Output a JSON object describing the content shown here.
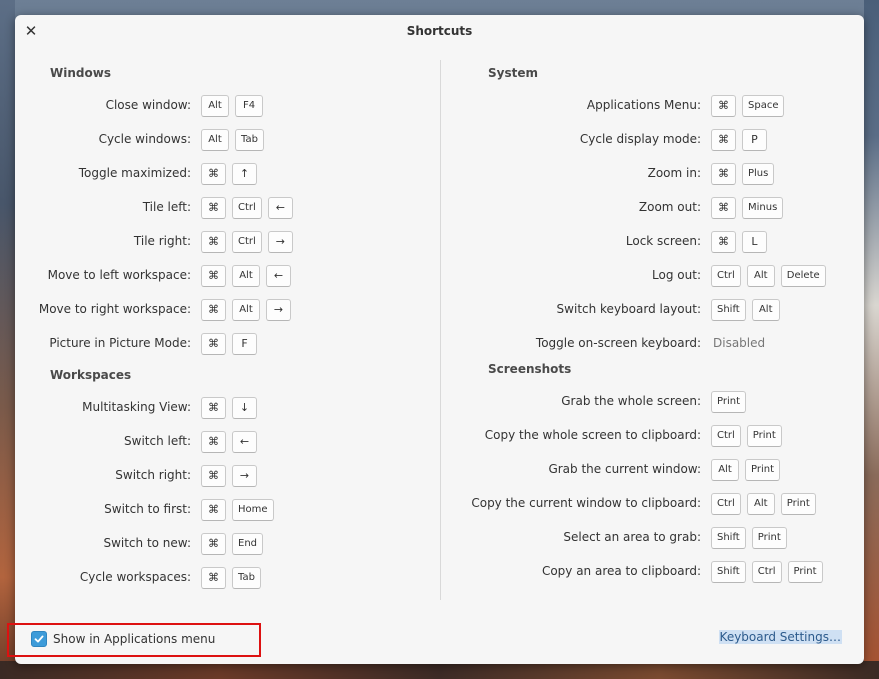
{
  "window": {
    "title": "Shortcuts"
  },
  "left_sections": [
    {
      "title": "Windows",
      "rows": [
        {
          "label": "Close window:",
          "keys": [
            "Alt",
            "F4"
          ]
        },
        {
          "label": "Cycle windows:",
          "keys": [
            "Alt",
            "Tab"
          ]
        },
        {
          "label": "Toggle maximized:",
          "keys": [
            "⌘",
            "↑"
          ]
        },
        {
          "label": "Tile left:",
          "keys": [
            "⌘",
            "Ctrl",
            "←"
          ]
        },
        {
          "label": "Tile right:",
          "keys": [
            "⌘",
            "Ctrl",
            "→"
          ]
        },
        {
          "label": "Move to left workspace:",
          "keys": [
            "⌘",
            "Alt",
            "←"
          ]
        },
        {
          "label": "Move to right workspace:",
          "keys": [
            "⌘",
            "Alt",
            "→"
          ]
        },
        {
          "label": "Picture in Picture Mode:",
          "keys": [
            "⌘",
            "F"
          ]
        }
      ]
    },
    {
      "title": "Workspaces",
      "rows": [
        {
          "label": "Multitasking View:",
          "keys": [
            "⌘",
            "↓"
          ]
        },
        {
          "label": "Switch left:",
          "keys": [
            "⌘",
            "←"
          ]
        },
        {
          "label": "Switch right:",
          "keys": [
            "⌘",
            "→"
          ]
        },
        {
          "label": "Switch to first:",
          "keys": [
            "⌘",
            "Home"
          ]
        },
        {
          "label": "Switch to new:",
          "keys": [
            "⌘",
            "End"
          ]
        },
        {
          "label": "Cycle workspaces:",
          "keys": [
            "⌘",
            "Tab"
          ]
        }
      ]
    }
  ],
  "right_sections": [
    {
      "title": "System",
      "rows": [
        {
          "label": "Applications Menu:",
          "keys": [
            "⌘",
            "Space"
          ]
        },
        {
          "label": "Cycle display mode:",
          "keys": [
            "⌘",
            "P"
          ]
        },
        {
          "label": "Zoom in:",
          "keys": [
            "⌘",
            "Plus"
          ]
        },
        {
          "label": "Zoom out:",
          "keys": [
            "⌘",
            "Minus"
          ]
        },
        {
          "label": "Lock screen:",
          "keys": [
            "⌘",
            "L"
          ]
        },
        {
          "label": "Log out:",
          "keys": [
            "Ctrl",
            "Alt",
            "Delete"
          ]
        },
        {
          "label": "Switch keyboard layout:",
          "keys": [
            "Shift",
            "Alt"
          ]
        },
        {
          "label": "Toggle on-screen keyboard:",
          "keys": [],
          "status": "Disabled"
        }
      ]
    },
    {
      "title": "Screenshots",
      "rows": [
        {
          "label": "Grab the whole screen:",
          "keys": [
            "Print"
          ]
        },
        {
          "label": "Copy the whole screen to clipboard:",
          "keys": [
            "Ctrl",
            "Print"
          ]
        },
        {
          "label": "Grab the current window:",
          "keys": [
            "Alt",
            "Print"
          ]
        },
        {
          "label": "Copy the current window to clipboard:",
          "keys": [
            "Ctrl",
            "Alt",
            "Print"
          ]
        },
        {
          "label": "Select an area to grab:",
          "keys": [
            "Shift",
            "Print"
          ]
        },
        {
          "label": "Copy an area to clipboard:",
          "keys": [
            "Shift",
            "Ctrl",
            "Print"
          ]
        }
      ]
    }
  ],
  "footer": {
    "show_in_menu_label": "Show in Applications menu",
    "show_in_menu_checked": true,
    "settings_link": "Keyboard Settings…"
  },
  "colors": {
    "accent": "#3d9bd9",
    "highlight_box": "#dd1111"
  }
}
